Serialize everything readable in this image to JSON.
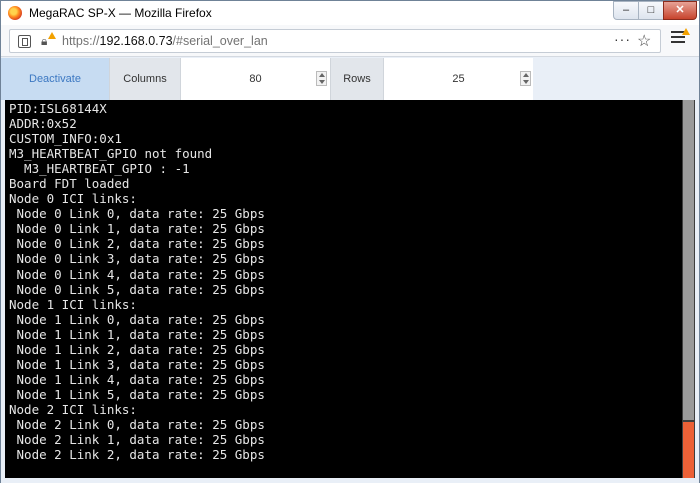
{
  "window": {
    "title": "MegaRAC SP-X — Mozilla Firefox",
    "controls": {
      "minimize": "–",
      "maximize": "□",
      "close": "✕"
    }
  },
  "navbar": {
    "url_scheme": "https://",
    "url_host": "192.168.0.73",
    "url_path": "/#serial_over_lan",
    "overflow_icon": "···",
    "bookmark_icon": "☆"
  },
  "toolbar": {
    "deactivate_label": "Deactivate",
    "columns_label": "Columns",
    "columns_value": "80",
    "rows_label": "Rows",
    "rows_value": "25"
  },
  "terminal": {
    "lines": [
      "PID:ISL68144X",
      "ADDR:0x52",
      "CUSTOM_INFO:0x1",
      "M3_HEARTBEAT_GPIO not found",
      "  M3_HEARTBEAT_GPIO : -1",
      "Board FDT loaded",
      "Node 0 ICI links:",
      " Node 0 Link 0, data rate: 25 Gbps",
      " Node 0 Link 1, data rate: 25 Gbps",
      " Node 0 Link 2, data rate: 25 Gbps",
      " Node 0 Link 3, data rate: 25 Gbps",
      " Node 0 Link 4, data rate: 25 Gbps",
      " Node 0 Link 5, data rate: 25 Gbps",
      "Node 1 ICI links:",
      " Node 1 Link 0, data rate: 25 Gbps",
      " Node 1 Link 1, data rate: 25 Gbps",
      " Node 1 Link 2, data rate: 25 Gbps",
      " Node 1 Link 3, data rate: 25 Gbps",
      " Node 1 Link 4, data rate: 25 Gbps",
      " Node 1 Link 5, data rate: 25 Gbps",
      "Node 2 ICI links:",
      " Node 2 Link 0, data rate: 25 Gbps",
      " Node 2 Link 1, data rate: 25 Gbps",
      " Node 2 Link 2, data rate: 25 Gbps"
    ]
  },
  "colors": {
    "accent": "#3c78c2",
    "terminal_bg": "#000000",
    "terminal_fg": "#e6e6e6",
    "scroll_thumb": "#ec6137"
  }
}
